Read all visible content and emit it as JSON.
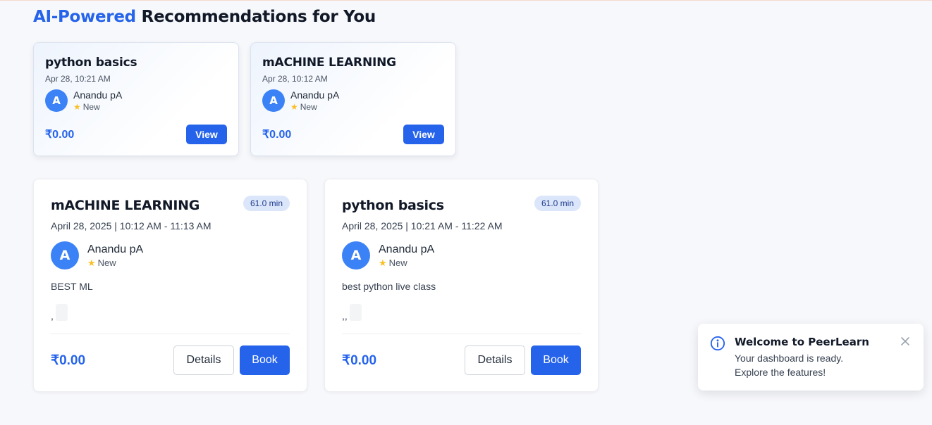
{
  "heading": {
    "accent": "AI-Powered",
    "rest": " Recommendations for You"
  },
  "recommendations": [
    {
      "title": "python basics",
      "date": "Apr 28, 10:21 AM",
      "tutor_initial": "A",
      "tutor_name": "Anandu pA",
      "badge": "New",
      "price": "₹0.00",
      "action": "View"
    },
    {
      "title": "mACHINE LEARNING",
      "date": "Apr 28, 10:12 AM",
      "tutor_initial": "A",
      "tutor_name": "Anandu pA",
      "badge": "New",
      "price": "₹0.00",
      "action": "View"
    }
  ],
  "sessions": [
    {
      "title": "mACHINE LEARNING",
      "duration": "61.0 min",
      "date": "April 28, 2025 | 10:12 AM - 11:13 AM",
      "tutor_initial": "A",
      "tutor_name": "Anandu pA",
      "badge": "New",
      "description": "BEST ML",
      "tags_separator": ",",
      "price": "₹0.00",
      "details_label": "Details",
      "book_label": "Book"
    },
    {
      "title": "python basics",
      "duration": "61.0 min",
      "date": "April 28, 2025 | 10:21 AM - 11:22 AM",
      "tutor_initial": "A",
      "tutor_name": "Anandu pA",
      "badge": "New",
      "description": "best python live class",
      "tags_separator": ",,",
      "price": "₹0.00",
      "details_label": "Details",
      "book_label": "Book"
    }
  ],
  "toast": {
    "title": "Welcome to PeerLearn",
    "message": "Your dashboard is ready. Explore the features!",
    "icon": "info-icon",
    "close_icon": "close-icon"
  },
  "colors": {
    "accent": "#2563eb",
    "avatar": "#3b82f6",
    "star": "#fbbf24",
    "background": "#f7f8fb"
  }
}
